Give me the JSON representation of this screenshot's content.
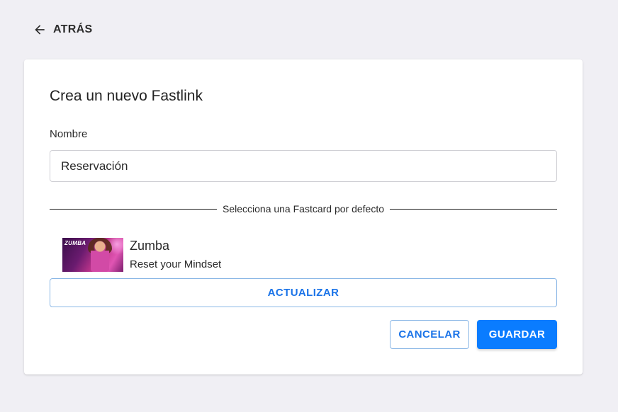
{
  "header": {
    "back_label": "ATRÁS",
    "back_icon": "arrow-left-icon"
  },
  "form": {
    "title": "Crea un nuevo Fastlink",
    "name_label": "Nombre",
    "name_value": "Reservación",
    "divider_text": "Selecciona una Fastcard por defecto",
    "fastcard": {
      "thumbnail_logo": "ZUMBA",
      "title": "Zumba",
      "subtitle": "Reset your Mindset"
    },
    "update_label": "ACTUALIZAR",
    "cancel_label": "CANCELAR",
    "save_label": "GUARDAR"
  },
  "colors": {
    "background": "#f0eff4",
    "accent": "#0a7cff",
    "outline": "#8ab7e6",
    "link_text": "#1a73e8"
  }
}
